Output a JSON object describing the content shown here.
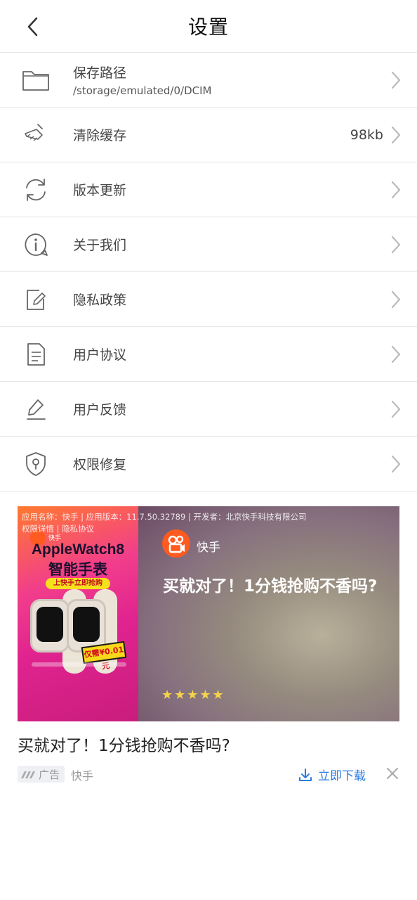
{
  "header": {
    "title": "设置"
  },
  "settings": [
    {
      "label": "保存路径",
      "sub": "/storage/emulated/0/DCIM",
      "icon": "folder-icon"
    },
    {
      "label": "清除缓存",
      "value": "98kb",
      "icon": "broom-icon"
    },
    {
      "label": "版本更新",
      "icon": "refresh-icon"
    },
    {
      "label": "关于我们",
      "icon": "info-icon"
    },
    {
      "label": "隐私政策",
      "icon": "edit-note-icon"
    },
    {
      "label": "用户协议",
      "icon": "document-icon"
    },
    {
      "label": "用户反馈",
      "icon": "pen-icon"
    },
    {
      "label": "权限修复",
      "icon": "shield-icon"
    }
  ],
  "ad": {
    "meta_line1": "应用名称：快手 | 应用版本：11.7.50.32789 | 开发者：北京快手科技有限公司",
    "permissions_link": "权限详情",
    "meta_sep": " | ",
    "privacy_link": "隐私协议",
    "creative": {
      "brand_small": "快手",
      "product_title": "AppleWatch8",
      "product_sub": "智能手表",
      "pill_text": "上快手立即抢购",
      "price_text": "仅需¥0.01元"
    },
    "app_name": "快手",
    "headline": "买就对了！1分钱抢购不香吗?",
    "stars": "★★★★★",
    "rating": 5,
    "caption": "买就对了！1分钱抢购不香吗?",
    "badge_label": "广告",
    "source": "快手",
    "download_label": "立即下载"
  },
  "colors": {
    "accent": "#2a7be0",
    "divider": "#e6e6e6",
    "star": "#f5d34a",
    "kuaishou": "#ff5a1f"
  }
}
